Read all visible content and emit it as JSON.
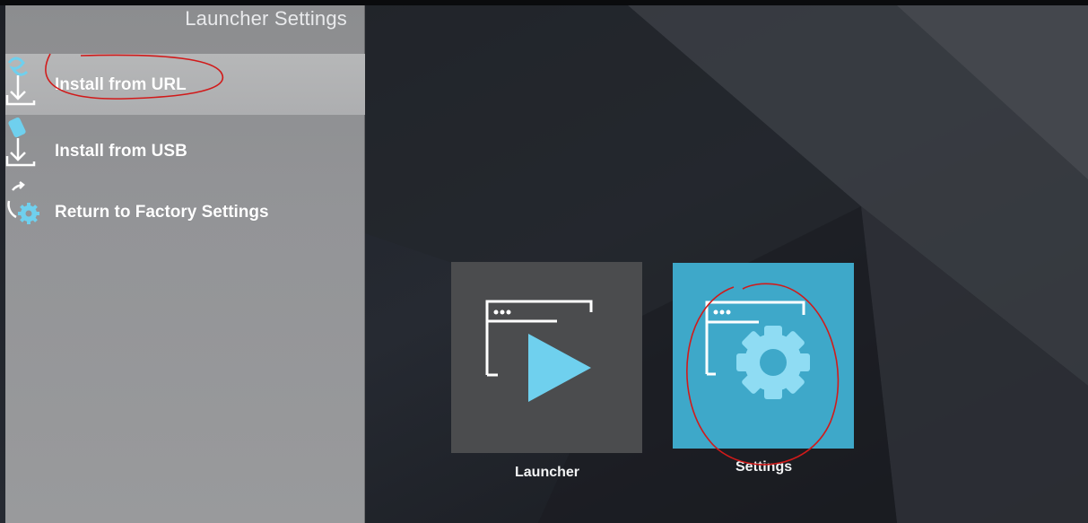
{
  "panel": {
    "title": "Launcher Settings",
    "items": [
      {
        "label": "Install from URL",
        "icon": "download-link-icon",
        "selected": true
      },
      {
        "label": "Install from USB",
        "icon": "usb-install-icon",
        "selected": false
      },
      {
        "label": "Return to Factory Settings",
        "icon": "factory-reset-icon",
        "selected": false
      }
    ]
  },
  "tiles": [
    {
      "label": "Launcher",
      "icon": "play-window-icon"
    },
    {
      "label": "Settings",
      "icon": "gear-window-icon"
    }
  ],
  "colors": {
    "panel_bg": "#939497",
    "selected_row": "#b2b3b5",
    "launcher_tile": "#4b4c4e",
    "settings_tile": "#3ea8c9",
    "icon_blue": "#6fd0ee",
    "annotation_red": "#d11a1a"
  }
}
